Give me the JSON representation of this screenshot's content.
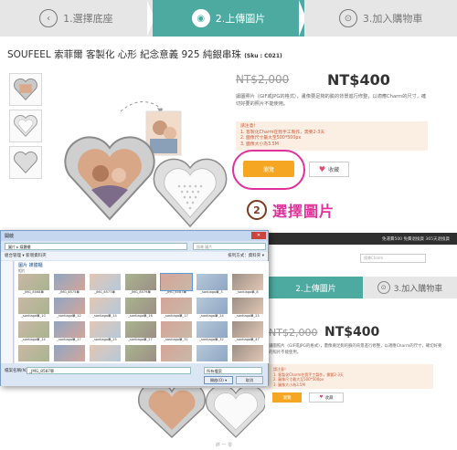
{
  "steps": [
    {
      "label": "1.選擇底座",
      "icon": "chevron-left-icon"
    },
    {
      "label": "2.上傳圖片",
      "icon": "image-icon"
    },
    {
      "label": "3.加入購物車",
      "icon": "cart-icon"
    }
  ],
  "product": {
    "title": "SOUFEEL 索菲爾 客製化 心形 紀念意義 925 純銀串珠",
    "sku": "(Sku : C021)",
    "old_price": "NT$2,000",
    "new_price": "NT$400",
    "description": "讓圖照片（GIF或JPG的格式），畫像要足夠的臉的背景進行修整，以適應Charm的尺寸，確切好要的照片不能使用。",
    "notice_title": "請注意！",
    "notice_lines": [
      "1. 客製化Charm在我手工製作，需要2-3天",
      "2. 圖像尺寸最大至500*500px",
      "3. 圖像大小為3.5M"
    ],
    "upload_label": "瀏覽",
    "favorite_label": "收藏"
  },
  "annotation": {
    "badge": "2",
    "text": "選擇圖片"
  },
  "lower": {
    "topbar_text": "免運費500 免費退換貨 365天退換貨",
    "search_placeholder": "搜尋Charm",
    "steps": [
      "2.上傳圖片",
      "3.加入購物車"
    ],
    "old_price": "NT$2,000",
    "new_price": "NT$400",
    "description": "讓圖照片（GIF或JPG的格式），畫像要足夠的臉的背景進行修整，以適應Charm的尺寸，確切好要的照片不能使用。",
    "notice_lines": [
      "請注意！",
      "1. 客製化Charm在我手工製作，需要2-3天",
      "2. 圖像尺寸最大至500*500px",
      "3. 圖像大小為3.5M"
    ],
    "upload_label": "瀏覽",
    "favorite_label": "收藏"
  },
  "dialog": {
    "title": "開啟",
    "close": "✕",
    "path": "圖片 ▸ 媒體櫃",
    "search_placeholder": "搜尋 圖片",
    "toolbar_left": "組合管理 ▾   新增資料夾",
    "toolbar_right": "排列方式：資料夾 ▾",
    "library_title": "圖片 媒體櫃",
    "library_sub": "相片",
    "files": [
      "_JMG_8568單",
      "_JMG_8575單",
      "_JMG_8577單",
      "_JMG_8579單",
      "_JMG_8587單",
      "_santiago單_3",
      "_santiago單_8",
      "_santiago單_10",
      "_santiago單_12",
      "_santiago單_14",
      "_santiago單_16",
      "_santiago單_17",
      "_santiago單_24",
      "_santiago單_25",
      "_santiago單_14",
      "_santiago單_17",
      "_santiago單_25",
      "_santiago單_27",
      "_santiago單_31",
      "_santiago單_32",
      "_santiago單_47",
      "",
      "",
      "",
      "",
      "",
      "",
      ""
    ],
    "selected_index": 4,
    "filename_label": "檔案名稱(N):",
    "filename_value": "_JMG_8587單",
    "filetype_value": "所有檔案",
    "open_label": "開啟(O) ▾",
    "cancel_label": "取消"
  },
  "footer": "終 一 零"
}
